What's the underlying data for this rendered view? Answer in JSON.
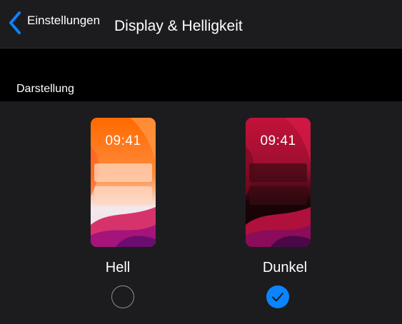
{
  "nav": {
    "back_label": "Einstellungen",
    "title": "Display & Helligkeit"
  },
  "appearance": {
    "section_header": "Darstellung",
    "options": [
      {
        "label": "Hell",
        "preview_time": "09:41",
        "selected": false
      },
      {
        "label": "Dunkel",
        "preview_time": "09:41",
        "selected": true
      }
    ]
  },
  "colors": {
    "accent": "#0a84ff",
    "background": "#000000",
    "grouped_background": "#1c1c1e"
  },
  "icons": {
    "back": "chevron-left-icon",
    "checkmark": "checkmark-icon",
    "radio_empty": "radio-unchecked-icon"
  }
}
